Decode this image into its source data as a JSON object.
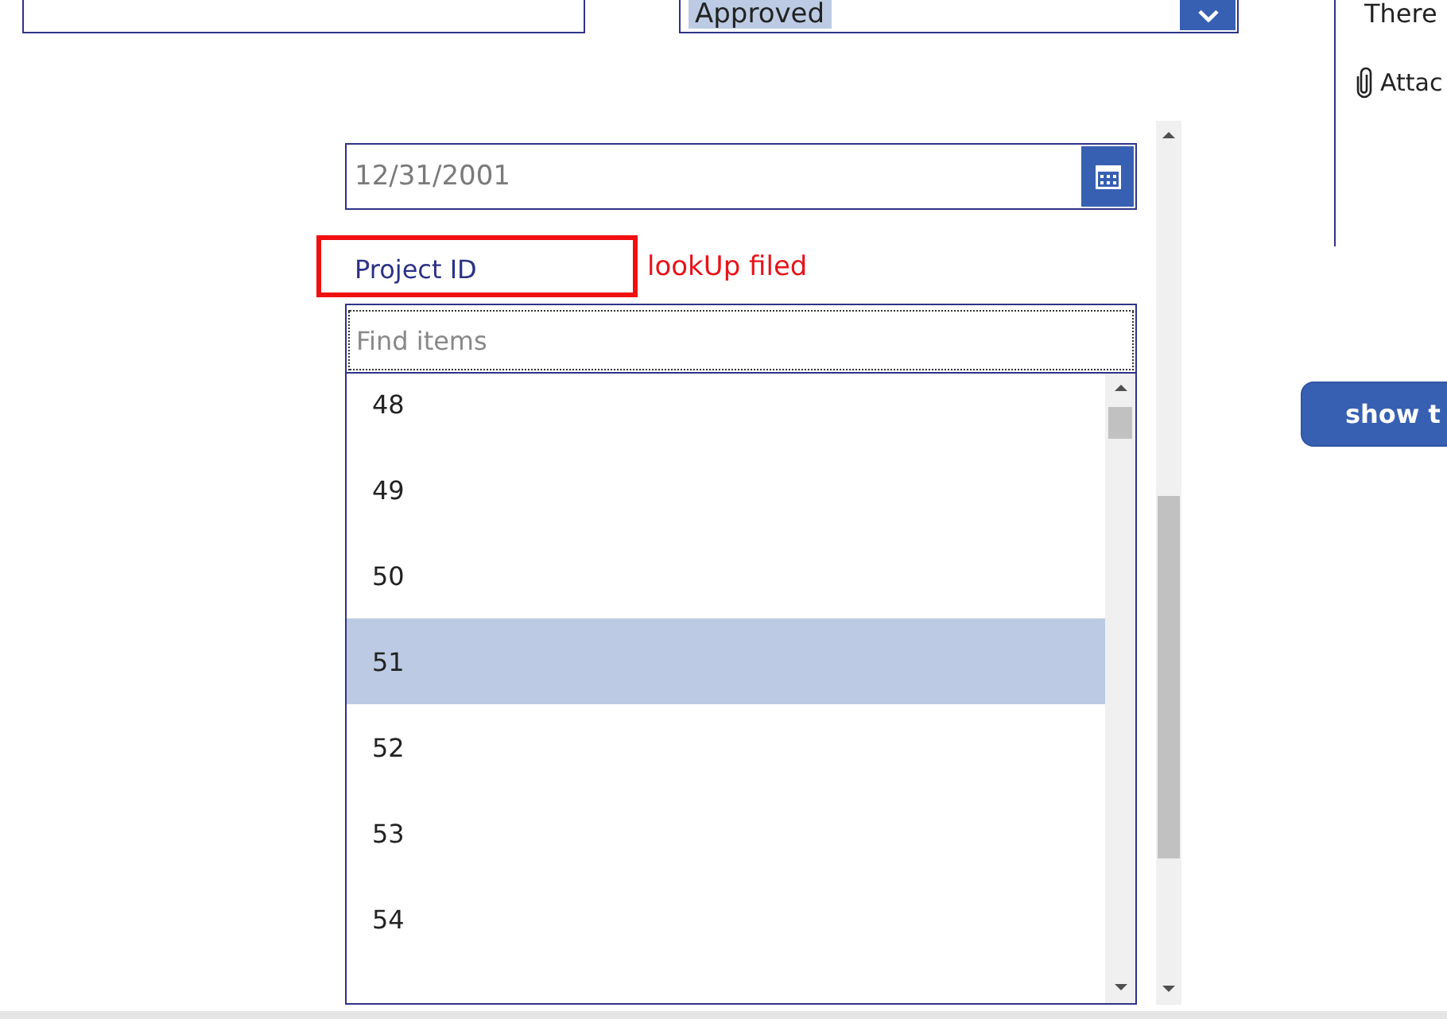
{
  "top_row": {
    "status_dropdown": {
      "value": "Approved",
      "highlighted": true
    }
  },
  "side_panel": {
    "note": "There",
    "attachments_label": "Attac"
  },
  "form": {
    "date_picker": {
      "value": "12/31/2001"
    },
    "lookup_label": {
      "text": "Project ID",
      "highlighted": true
    },
    "annotation": "lookUp filed",
    "combo_box": {
      "search_placeholder": "Find items",
      "items": [
        {
          "label": "48",
          "selected": false
        },
        {
          "label": "49",
          "selected": false
        },
        {
          "label": "50",
          "selected": false
        },
        {
          "label": "51",
          "selected": true
        },
        {
          "label": "52",
          "selected": false
        },
        {
          "label": "53",
          "selected": false
        },
        {
          "label": "54",
          "selected": false
        }
      ]
    }
  },
  "show_button": {
    "label": "show t"
  }
}
